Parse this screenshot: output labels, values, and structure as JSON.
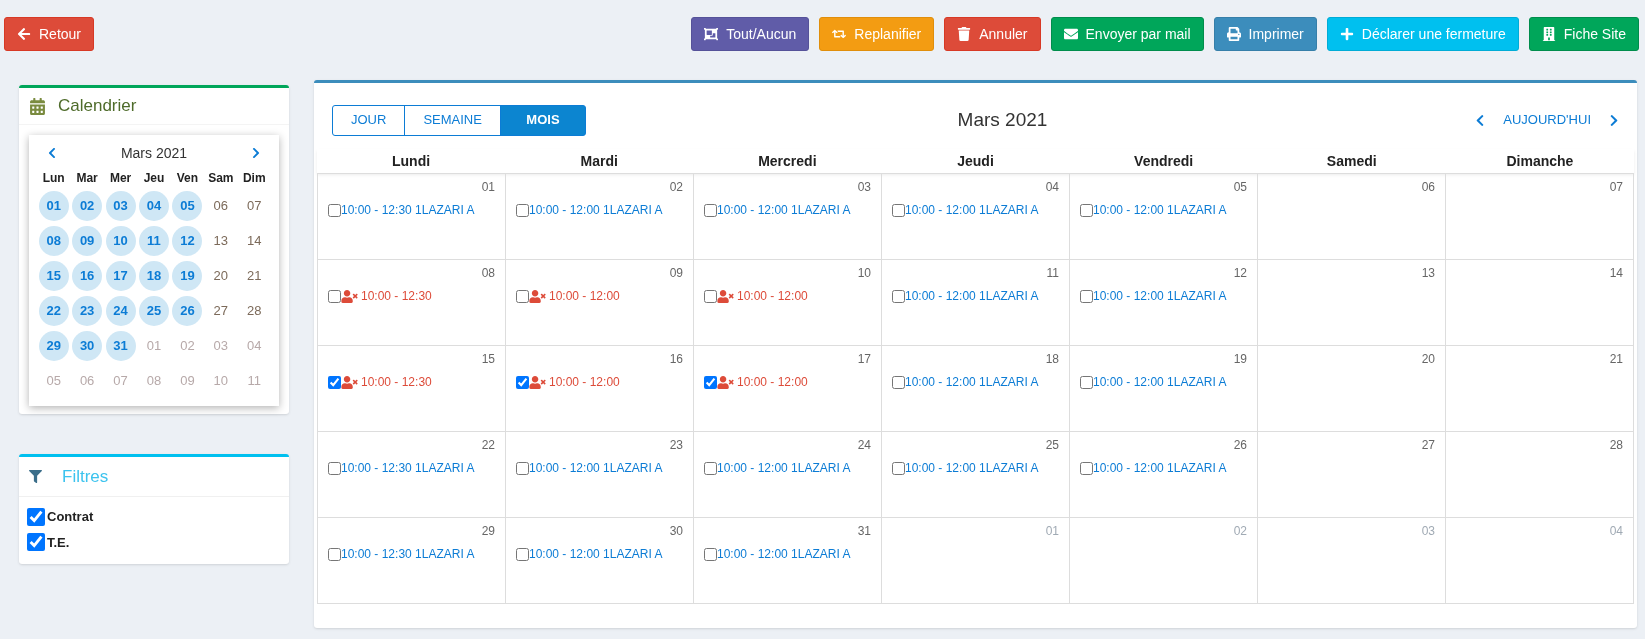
{
  "back_button": {
    "label": "Retour",
    "kind": "back"
  },
  "actions": [
    {
      "label": "Tout/Aucun",
      "kind": "select"
    },
    {
      "label": "Replanifier",
      "kind": "reschedule"
    },
    {
      "label": "Annuler",
      "kind": "cancel"
    },
    {
      "label": "Envoyer par mail",
      "kind": "mail"
    },
    {
      "label": "Imprimer",
      "kind": "print"
    },
    {
      "label": "Déclarer une fermeture",
      "kind": "closure"
    },
    {
      "label": "Fiche Site",
      "kind": "site"
    }
  ],
  "calendar_panel": {
    "title": "Calendrier",
    "month": "Mars 2021",
    "weekdays": [
      "Lun",
      "Mar",
      "Mer",
      "Jeu",
      "Ven",
      "Sam",
      "Dim"
    ],
    "days": [
      {
        "label": "01",
        "highlighted": true,
        "outside": false
      },
      {
        "label": "02",
        "highlighted": true,
        "outside": false
      },
      {
        "label": "03",
        "highlighted": true,
        "outside": false
      },
      {
        "label": "04",
        "highlighted": true,
        "outside": false
      },
      {
        "label": "05",
        "highlighted": true,
        "outside": false
      },
      {
        "label": "06",
        "highlighted": false,
        "outside": false
      },
      {
        "label": "07",
        "highlighted": false,
        "outside": false
      },
      {
        "label": "08",
        "highlighted": true,
        "outside": false
      },
      {
        "label": "09",
        "highlighted": true,
        "outside": false
      },
      {
        "label": "10",
        "highlighted": true,
        "outside": false
      },
      {
        "label": "11",
        "highlighted": true,
        "outside": false
      },
      {
        "label": "12",
        "highlighted": true,
        "outside": false
      },
      {
        "label": "13",
        "highlighted": false,
        "outside": false
      },
      {
        "label": "14",
        "highlighted": false,
        "outside": false
      },
      {
        "label": "15",
        "highlighted": true,
        "outside": false
      },
      {
        "label": "16",
        "highlighted": true,
        "outside": false
      },
      {
        "label": "17",
        "highlighted": true,
        "outside": false
      },
      {
        "label": "18",
        "highlighted": true,
        "outside": false
      },
      {
        "label": "19",
        "highlighted": true,
        "outside": false
      },
      {
        "label": "20",
        "highlighted": false,
        "outside": false
      },
      {
        "label": "21",
        "highlighted": false,
        "outside": false
      },
      {
        "label": "22",
        "highlighted": true,
        "outside": false
      },
      {
        "label": "23",
        "highlighted": true,
        "outside": false
      },
      {
        "label": "24",
        "highlighted": true,
        "outside": false
      },
      {
        "label": "25",
        "highlighted": true,
        "outside": false
      },
      {
        "label": "26",
        "highlighted": true,
        "outside": false
      },
      {
        "label": "27",
        "highlighted": false,
        "outside": false
      },
      {
        "label": "28",
        "highlighted": false,
        "outside": false
      },
      {
        "label": "29",
        "highlighted": true,
        "outside": false
      },
      {
        "label": "30",
        "highlighted": true,
        "outside": false
      },
      {
        "label": "31",
        "highlighted": true,
        "outside": false
      },
      {
        "label": "01",
        "highlighted": false,
        "outside": true
      },
      {
        "label": "02",
        "highlighted": false,
        "outside": true
      },
      {
        "label": "03",
        "highlighted": false,
        "outside": true
      },
      {
        "label": "04",
        "highlighted": false,
        "outside": true
      },
      {
        "label": "05",
        "highlighted": false,
        "outside": true
      },
      {
        "label": "06",
        "highlighted": false,
        "outside": true
      },
      {
        "label": "07",
        "highlighted": false,
        "outside": true
      },
      {
        "label": "08",
        "highlighted": false,
        "outside": true
      },
      {
        "label": "09",
        "highlighted": false,
        "outside": true
      },
      {
        "label": "10",
        "highlighted": false,
        "outside": true
      },
      {
        "label": "11",
        "highlighted": false,
        "outside": true
      }
    ]
  },
  "filters_panel": {
    "title": "Filtres",
    "items": [
      {
        "label": "Contrat",
        "checked": true
      },
      {
        "label": "T.E.",
        "checked": true
      }
    ]
  },
  "main": {
    "views": [
      {
        "label": "JOUR",
        "selected": false
      },
      {
        "label": "SEMAINE",
        "selected": false
      },
      {
        "label": "MOIS",
        "selected": true
      }
    ],
    "title": "Mars 2021",
    "today": "AUJOURD'HUI",
    "weekdays": [
      "Lundi",
      "Mardi",
      "Mercredi",
      "Jeudi",
      "Vendredi",
      "Samedi",
      "Dimanche"
    ],
    "weeks": [
      [
        {
          "date": "01",
          "outside": false,
          "events": [
            {
              "kind": "session",
              "text": "10:00 - 12:30 1LAZARI A",
              "checked": false
            }
          ]
        },
        {
          "date": "02",
          "outside": false,
          "events": [
            {
              "kind": "session",
              "text": "10:00 - 12:00 1LAZARI A",
              "checked": false
            }
          ]
        },
        {
          "date": "03",
          "outside": false,
          "events": [
            {
              "kind": "session",
              "text": "10:00 - 12:00 1LAZARI A",
              "checked": false
            }
          ]
        },
        {
          "date": "04",
          "outside": false,
          "events": [
            {
              "kind": "session",
              "text": "10:00 - 12:00 1LAZARI A",
              "checked": false
            }
          ]
        },
        {
          "date": "05",
          "outside": false,
          "events": [
            {
              "kind": "session",
              "text": "10:00 - 12:00 1LAZARI A",
              "checked": false
            }
          ]
        },
        {
          "date": "06",
          "outside": false
        },
        {
          "date": "07",
          "outside": false
        }
      ],
      [
        {
          "date": "08",
          "outside": false,
          "events": [
            {
              "kind": "absence",
              "text": "10:00 - 12:30",
              "checked": false
            }
          ]
        },
        {
          "date": "09",
          "outside": false,
          "events": [
            {
              "kind": "absence",
              "text": "10:00 - 12:00",
              "checked": false
            }
          ]
        },
        {
          "date": "10",
          "outside": false,
          "events": [
            {
              "kind": "absence",
              "text": "10:00 - 12:00",
              "checked": false
            }
          ]
        },
        {
          "date": "11",
          "outside": false,
          "events": [
            {
              "kind": "session",
              "text": "10:00 - 12:00 1LAZARI A",
              "checked": false
            }
          ]
        },
        {
          "date": "12",
          "outside": false,
          "events": [
            {
              "kind": "session",
              "text": "10:00 - 12:00 1LAZARI A",
              "checked": false
            }
          ]
        },
        {
          "date": "13",
          "outside": false
        },
        {
          "date": "14",
          "outside": false
        }
      ],
      [
        {
          "date": "15",
          "outside": false,
          "events": [
            {
              "kind": "absence",
              "text": "10:00 - 12:30",
              "checked": true
            }
          ]
        },
        {
          "date": "16",
          "outside": false,
          "events": [
            {
              "kind": "absence",
              "text": "10:00 - 12:00",
              "checked": true
            }
          ]
        },
        {
          "date": "17",
          "outside": false,
          "events": [
            {
              "kind": "absence",
              "text": "10:00 - 12:00",
              "checked": true
            }
          ]
        },
        {
          "date": "18",
          "outside": false,
          "events": [
            {
              "kind": "session",
              "text": "10:00 - 12:00 1LAZARI A",
              "checked": false
            }
          ]
        },
        {
          "date": "19",
          "outside": false,
          "events": [
            {
              "kind": "session",
              "text": "10:00 - 12:00 1LAZARI A",
              "checked": false
            }
          ]
        },
        {
          "date": "20",
          "outside": false
        },
        {
          "date": "21",
          "outside": false
        }
      ],
      [
        {
          "date": "22",
          "outside": false,
          "events": [
            {
              "kind": "session",
              "text": "10:00 - 12:30 1LAZARI A",
              "checked": false
            }
          ]
        },
        {
          "date": "23",
          "outside": false,
          "events": [
            {
              "kind": "session",
              "text": "10:00 - 12:00 1LAZARI A",
              "checked": false
            }
          ]
        },
        {
          "date": "24",
          "outside": false,
          "events": [
            {
              "kind": "session",
              "text": "10:00 - 12:00 1LAZARI A",
              "checked": false
            }
          ]
        },
        {
          "date": "25",
          "outside": false,
          "events": [
            {
              "kind": "session",
              "text": "10:00 - 12:00 1LAZARI A",
              "checked": false
            }
          ]
        },
        {
          "date": "26",
          "outside": false,
          "events": [
            {
              "kind": "session",
              "text": "10:00 - 12:00 1LAZARI A",
              "checked": false
            }
          ]
        },
        {
          "date": "27",
          "outside": false
        },
        {
          "date": "28",
          "outside": false
        }
      ],
      [
        {
          "date": "29",
          "outside": false,
          "events": [
            {
              "kind": "session",
              "text": "10:00 - 12:30 1LAZARI A",
              "checked": false
            }
          ]
        },
        {
          "date": "30",
          "outside": false,
          "events": [
            {
              "kind": "session",
              "text": "10:00 - 12:00 1LAZARI A",
              "checked": false
            }
          ]
        },
        {
          "date": "31",
          "outside": false,
          "events": [
            {
              "kind": "session",
              "text": "10:00 - 12:00 1LAZARI A",
              "checked": false
            }
          ]
        },
        {
          "date": "01",
          "outside": true
        },
        {
          "date": "02",
          "outside": true
        },
        {
          "date": "03",
          "outside": true
        },
        {
          "date": "04",
          "outside": true
        }
      ]
    ]
  }
}
